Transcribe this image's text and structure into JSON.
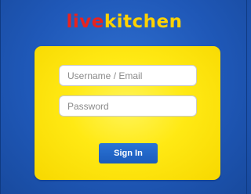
{
  "app": {
    "logo_part1": "live",
    "logo_part2": "kitchen"
  },
  "login": {
    "username_placeholder": "Username / Email",
    "username_value": "",
    "password_placeholder": "Password",
    "password_value": "",
    "signin_label": "Sign In"
  },
  "colors": {
    "background": "#1f58b8",
    "card": "#ffe914",
    "logo_live": "#e8231f",
    "logo_kitchen": "#ffd200",
    "button": "#1f60c2"
  }
}
